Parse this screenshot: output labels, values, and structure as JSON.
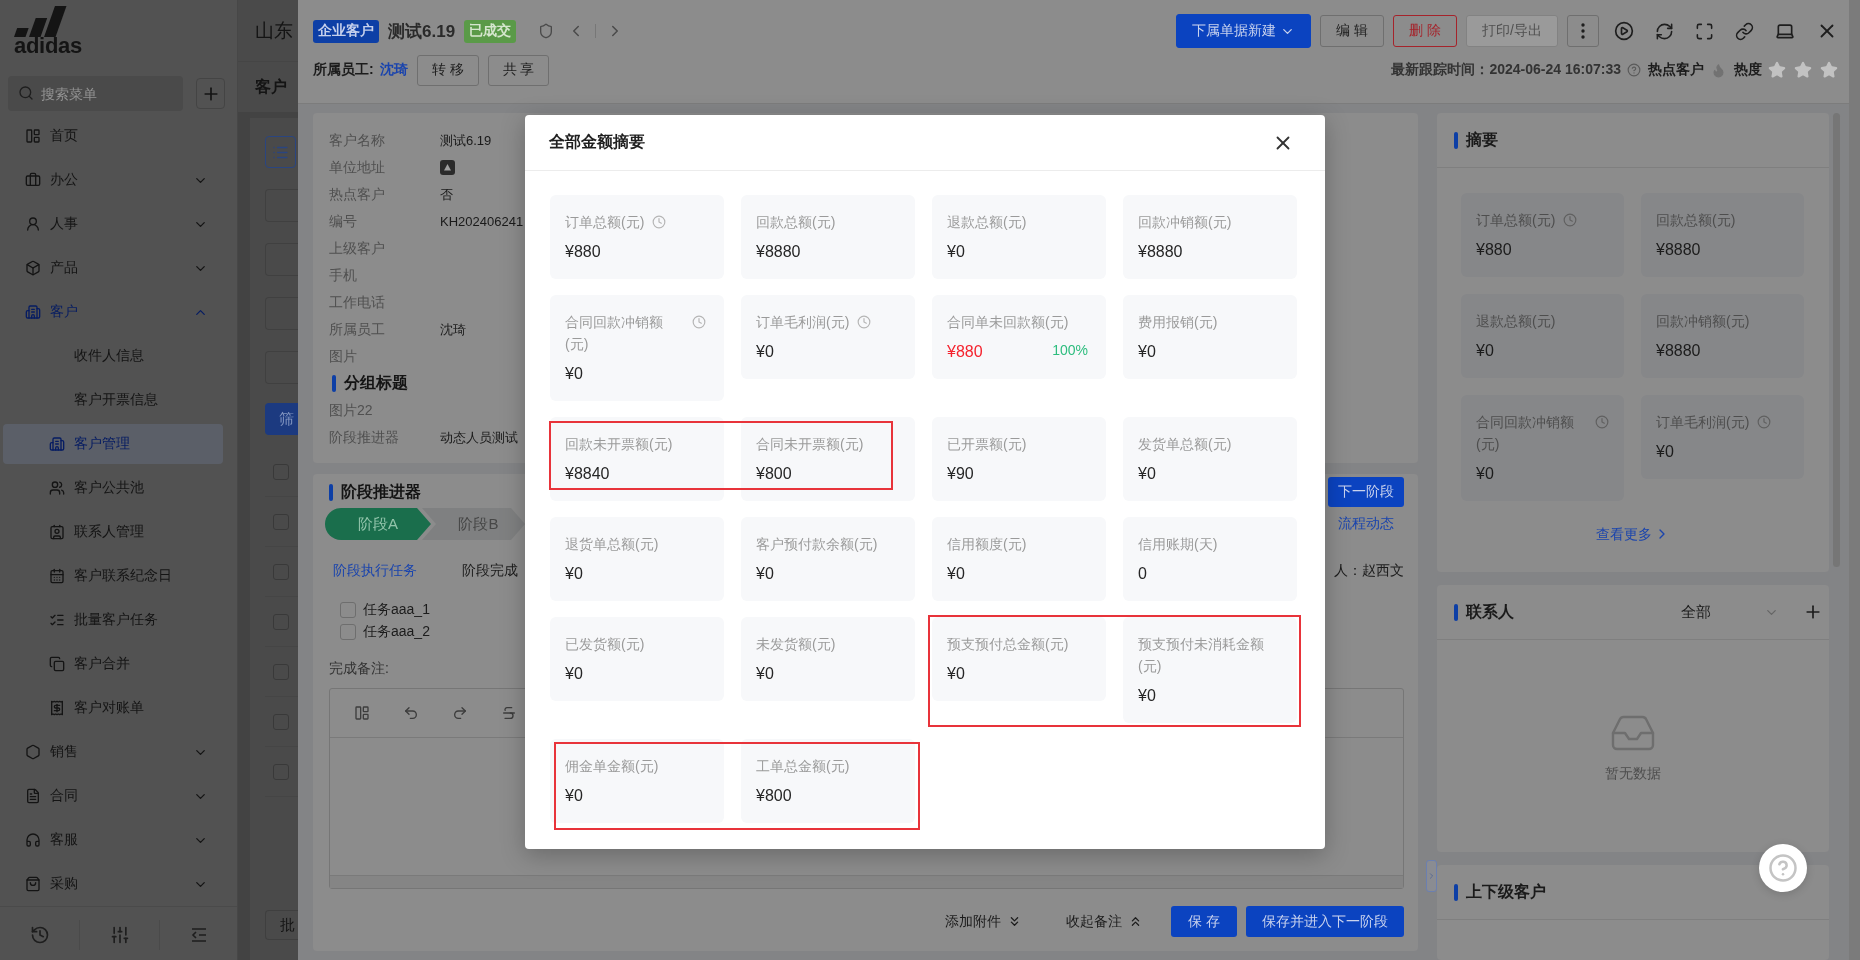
{
  "sidebar": {
    "logo": "adidas",
    "search": {
      "placeholder": "搜索菜单"
    },
    "menu": [
      {
        "label": "首页",
        "selected": false
      },
      {
        "label": "办公",
        "selected": false,
        "expanded": false
      },
      {
        "label": "人事",
        "selected": false,
        "expanded": false
      },
      {
        "label": "产品",
        "selected": false,
        "expanded": false
      },
      {
        "label": "客户",
        "selected": false,
        "expanded": true,
        "children": [
          {
            "label": "收件人信息",
            "selected": false
          },
          {
            "label": "客户开票信息",
            "selected": false
          },
          {
            "label": "客户管理",
            "selected": true
          },
          {
            "label": "客户公共池",
            "selected": false
          },
          {
            "label": "联系人管理",
            "selected": false
          },
          {
            "label": "客户联系纪念日",
            "selected": false
          },
          {
            "label": "批量客户任务",
            "selected": false
          },
          {
            "label": "客户合并",
            "selected": false
          },
          {
            "label": "客户对账单",
            "selected": false
          }
        ]
      },
      {
        "label": "销售",
        "selected": false,
        "expanded": false
      },
      {
        "label": "合同",
        "selected": false,
        "expanded": false
      },
      {
        "label": "客服",
        "selected": false,
        "expanded": false
      },
      {
        "label": "采购",
        "selected": false,
        "expanded": false
      }
    ]
  },
  "page": {
    "title": "山东",
    "tab": "客户",
    "filter_button": "筛",
    "rows": [
      {
        "checked": false
      },
      {
        "checked": false
      },
      {
        "checked": false
      },
      {
        "checked": false
      },
      {
        "checked": false
      },
      {
        "checked": false
      },
      {
        "checked": false
      }
    ],
    "batch_button": "批"
  },
  "record": {
    "type_badge": "企业客户",
    "name": "测试6.19",
    "status_badge": "已成交",
    "owner_label": "所属员工:",
    "owner": "沈琦",
    "actions": [
      "转 移",
      "共 享"
    ],
    "toolbar": [
      {
        "label": "下属单据新建",
        "kind": "primary",
        "disabled": false
      },
      {
        "label": "编 辑",
        "kind": "default",
        "disabled": false
      },
      {
        "label": "删 除",
        "kind": "danger",
        "disabled": false
      },
      {
        "label": "打印/导出",
        "kind": "default",
        "disabled": true
      }
    ],
    "tracking": "最新跟踪时间：2024-06-24 16:07:33",
    "hot_label": "热点客户",
    "hot": false,
    "heat_label": "热度",
    "stars": 0
  },
  "details": [
    {
      "kind": "field",
      "label": "客户名称",
      "value": "测试6.19"
    },
    {
      "kind": "image",
      "label": "单位地址"
    },
    {
      "kind": "field",
      "label": "热点客户",
      "value": "否"
    },
    {
      "kind": "field",
      "label": "编号",
      "value": "KH202406241"
    },
    {
      "kind": "field",
      "label": "上级客户"
    },
    {
      "kind": "field",
      "label": "手机"
    },
    {
      "kind": "field",
      "label": "工作电话"
    },
    {
      "kind": "field",
      "label": "所属员工",
      "value": "沈琦"
    },
    {
      "kind": "field",
      "label": "图片"
    },
    {
      "kind": "section",
      "label": "分组标题"
    },
    {
      "kind": "field",
      "label": "图片22"
    },
    {
      "kind": "field",
      "label": "阶段推进器",
      "value": "动态人员测试"
    }
  ],
  "stage_panel": {
    "title": "阶段推进器",
    "next_button": "下一阶段",
    "flow_link": "流程动态",
    "stages": [
      {
        "label": "阶段A",
        "selected": true
      },
      {
        "label": "阶段B",
        "selected": false
      }
    ],
    "tabs": [
      {
        "label": "阶段执行任务",
        "selected": true
      },
      {
        "label": "阶段完成",
        "selected": false
      }
    ],
    "assignee": "人：赵西文",
    "tasks": [
      {
        "label": "任务aaa_1",
        "checked": false
      },
      {
        "label": "任务aaa_2",
        "checked": false
      }
    ],
    "note_label": "完成备注:",
    "toggles": [
      {
        "label": "添加附件",
        "expanded": false
      },
      {
        "label": "收起备注",
        "expanded": true
      }
    ],
    "save_button": "保 存",
    "save_next_button": "保存并进入下一阶段"
  },
  "summary": {
    "title": "摘要",
    "cards": [
      {
        "label": "订单总额(元)",
        "value": "¥880",
        "clock": true,
        "alert": false
      },
      {
        "label": "回款总额(元)",
        "value": "¥8880",
        "clock": false,
        "alert": false
      },
      {
        "label": "退款总额(元)",
        "value": "¥0",
        "clock": false,
        "alert": false
      },
      {
        "label": "回款冲销额(元)",
        "value": "¥8880",
        "clock": false,
        "alert": false
      },
      {
        "label": "合同回款冲销额(元)",
        "value": "¥0",
        "clock": true,
        "alert": false
      },
      {
        "label": "订单毛利润(元)",
        "value": "¥0",
        "clock": true,
        "alert": false
      }
    ],
    "more_link": "查看更多"
  },
  "contacts": {
    "title": "联系人",
    "filter": "全部",
    "empty_text": "暂无数据"
  },
  "hierarchy": {
    "title": "上下级客户"
  },
  "amount_modal": {
    "title": "全部金额摘要",
    "cards": [
      {
        "label": "订单总额(元)",
        "value": "¥880",
        "clock": true,
        "alert": false
      },
      {
        "label": "回款总额(元)",
        "value": "¥8880",
        "clock": false,
        "alert": false
      },
      {
        "label": "退款总额(元)",
        "value": "¥0",
        "clock": false,
        "alert": false
      },
      {
        "label": "回款冲销额(元)",
        "value": "¥8880",
        "clock": false,
        "alert": false
      },
      {
        "label": "合同回款冲销额(元)",
        "value": "¥0",
        "clock": true,
        "alert": false
      },
      {
        "label": "订单毛利润(元)",
        "value": "¥0",
        "clock": true,
        "alert": false
      },
      {
        "label": "合同单未回款额(元)",
        "value": "¥880",
        "clock": false,
        "alert": true,
        "ratio": "100%"
      },
      {
        "label": "费用报销(元)",
        "value": "¥0",
        "clock": false,
        "alert": false
      },
      {
        "label": "回款未开票额(元)",
        "value": "¥8840",
        "clock": false,
        "alert": false
      },
      {
        "label": "合同未开票额(元)",
        "value": "¥800",
        "clock": false,
        "alert": false
      },
      {
        "label": "已开票额(元)",
        "value": "¥90",
        "clock": false,
        "alert": false
      },
      {
        "label": "发货单总额(元)",
        "value": "¥0",
        "clock": false,
        "alert": false
      },
      {
        "label": "退货单总额(元)",
        "value": "¥0",
        "clock": false,
        "alert": false
      },
      {
        "label": "客户预付款余额(元)",
        "value": "¥0",
        "clock": false,
        "alert": false
      },
      {
        "label": "信用额度(元)",
        "value": "¥0",
        "clock": false,
        "alert": false
      },
      {
        "label": "信用账期(天)",
        "value": "0",
        "clock": false,
        "alert": false
      },
      {
        "label": "已发货额(元)",
        "value": "¥0",
        "clock": false,
        "alert": false
      },
      {
        "label": "未发货额(元)",
        "value": "¥0",
        "clock": false,
        "alert": false
      },
      {
        "label": "预支预付总金额(元)",
        "value": "¥0",
        "clock": false,
        "alert": false
      },
      {
        "label": "预支预付未消耗金额(元)",
        "value": "¥0",
        "clock": false,
        "alert": false
      },
      {
        "label": "佣金单金额(元)",
        "value": "¥0",
        "clock": false,
        "alert": false
      },
      {
        "label": "工单总金额(元)",
        "value": "¥800",
        "clock": false,
        "alert": false
      }
    ]
  }
}
